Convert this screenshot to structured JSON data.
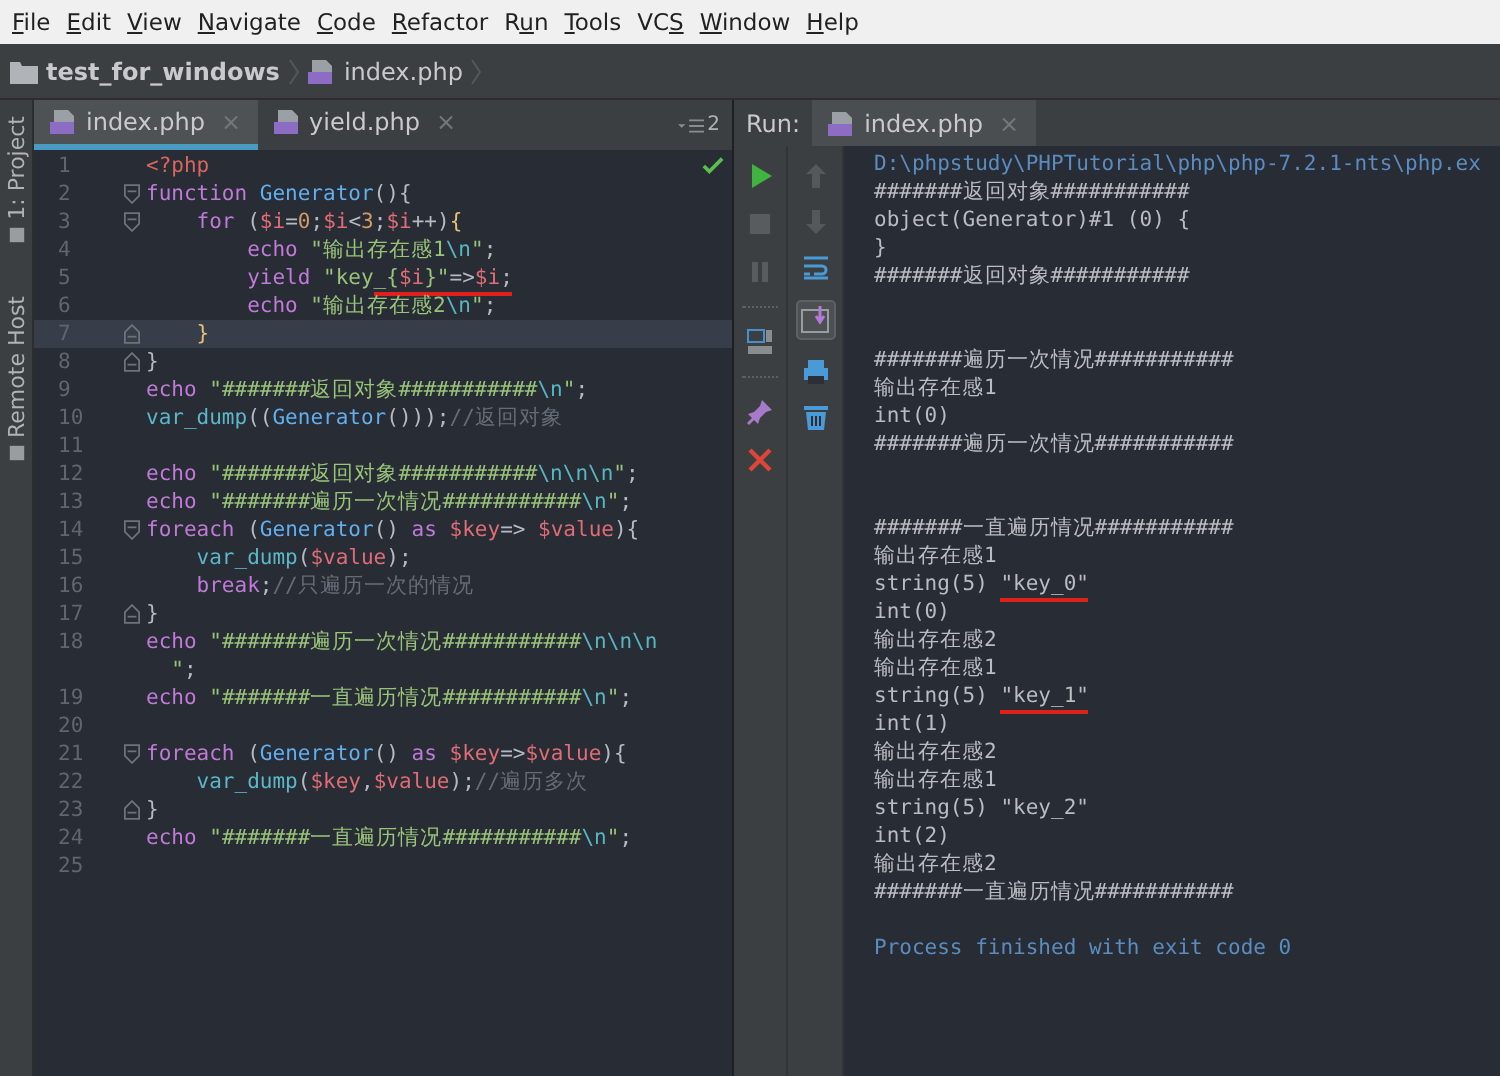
{
  "menu": [
    {
      "key": "F",
      "post": "ile"
    },
    {
      "key": "E",
      "post": "dit"
    },
    {
      "key": "V",
      "post": "iew"
    },
    {
      "key": "N",
      "post": "avigate"
    },
    {
      "key": "C",
      "post": "ode"
    },
    {
      "key": "R",
      "post": "efactor"
    },
    {
      "pre": "R",
      "key": "u",
      "post": "n"
    },
    {
      "key": "T",
      "post": "ools"
    },
    {
      "pre": "VC",
      "key": "S"
    },
    {
      "key": "W",
      "post": "indow"
    },
    {
      "key": "H",
      "post": "elp"
    }
  ],
  "breadcrumb": {
    "project": "test_for_windows",
    "file": "index.php"
  },
  "tool_strip": [
    {
      "label": "1: Project"
    },
    {
      "label": "Remote Host"
    }
  ],
  "editor": {
    "tabs": [
      {
        "label": "index.php",
        "close": "×",
        "selected": true
      },
      {
        "label": "yield.php",
        "close": "×",
        "selected": false
      }
    ],
    "tab_count": "2",
    "lines": [
      {
        "number": "1",
        "current": false,
        "kind": "plain",
        "segments": [
          {
            "kind": "tag",
            "text": "<?php"
          }
        ]
      },
      {
        "number": "2",
        "current": false,
        "kind": "fold-start",
        "segments": [
          {
            "kind": "kw",
            "text": "function"
          },
          {
            "kind": "fn",
            "text": " Generator"
          },
          {
            "kind": "plain",
            "text": "(){"
          }
        ]
      },
      {
        "number": "3",
        "current": false,
        "kind": "fold-start",
        "segments": [
          {
            "kind": "kw",
            "text": "    for"
          },
          {
            "kind": "plain",
            "text": " ("
          },
          {
            "kind": "var",
            "text": "$i"
          },
          {
            "kind": "plain",
            "text": "="
          },
          {
            "kind": "num",
            "text": "0"
          },
          {
            "kind": "plain",
            "text": ";"
          },
          {
            "kind": "var",
            "text": "$i"
          },
          {
            "kind": "plain",
            "text": "<"
          },
          {
            "kind": "num",
            "text": "3"
          },
          {
            "kind": "plain",
            "text": ";"
          },
          {
            "kind": "var",
            "text": "$i"
          },
          {
            "kind": "plain",
            "text": "++)"
          },
          {
            "kind": "brace",
            "text": "{"
          }
        ]
      },
      {
        "number": "4",
        "current": false,
        "kind": "plain",
        "segments": [
          {
            "kind": "kw",
            "text": "        echo"
          },
          {
            "kind": "str",
            "text": " \"输出存在感1"
          },
          {
            "kind": "esc",
            "text": "\\n"
          },
          {
            "kind": "str",
            "text": "\""
          },
          {
            "kind": "plain",
            "text": ";"
          }
        ]
      },
      {
        "number": "5",
        "current": false,
        "kind": "plain",
        "segments": [
          {
            "kind": "kw",
            "text": "        yield"
          },
          {
            "kind": "str",
            "text": " \"key"
          },
          {
            "kind": "annotated",
            "segments": [
              {
                "kind": "str",
                "text": "_{"
              },
              {
                "kind": "var",
                "text": "$i"
              },
              {
                "kind": "str",
                "text": "}\""
              },
              {
                "kind": "plain",
                "text": "=>"
              },
              {
                "kind": "var",
                "text": "$i"
              },
              {
                "kind": "plain",
                "text": ";"
              }
            ]
          }
        ]
      },
      {
        "number": "6",
        "current": false,
        "kind": "plain",
        "segments": [
          {
            "kind": "kw",
            "text": "        echo"
          },
          {
            "kind": "str",
            "text": " \"输出存在感2"
          },
          {
            "kind": "esc",
            "text": "\\n"
          },
          {
            "kind": "str",
            "text": "\""
          },
          {
            "kind": "plain",
            "text": ";"
          }
        ]
      },
      {
        "number": "7",
        "current": true,
        "kind": "fold-end",
        "segments": [
          {
            "kind": "brace",
            "text": "    }"
          }
        ]
      },
      {
        "number": "8",
        "current": false,
        "kind": "fold-end",
        "segments": [
          {
            "kind": "plain",
            "text": "}"
          }
        ]
      },
      {
        "number": "9",
        "current": false,
        "kind": "plain",
        "segments": [
          {
            "kind": "kw",
            "text": "echo"
          },
          {
            "kind": "str",
            "text": " \"#######返回对象###########"
          },
          {
            "kind": "esc",
            "text": "\\n"
          },
          {
            "kind": "str",
            "text": "\""
          },
          {
            "kind": "plain",
            "text": ";"
          }
        ]
      },
      {
        "number": "10",
        "current": false,
        "kind": "plain",
        "segments": [
          {
            "kind": "builtin",
            "text": "var_dump"
          },
          {
            "kind": "plain",
            "text": "(("
          },
          {
            "kind": "fn",
            "text": "Generator"
          },
          {
            "kind": "plain",
            "text": "()));"
          },
          {
            "kind": "comment",
            "text": "//返回对象"
          }
        ]
      },
      {
        "number": "11",
        "current": false,
        "kind": "plain"
      },
      {
        "number": "12",
        "current": false,
        "kind": "plain",
        "segments": [
          {
            "kind": "kw",
            "text": "echo"
          },
          {
            "kind": "str",
            "text": " \"#######返回对象###########"
          },
          {
            "kind": "esc",
            "text": "\\n\\n\\n"
          },
          {
            "kind": "str",
            "text": "\""
          },
          {
            "kind": "plain",
            "text": ";"
          }
        ]
      },
      {
        "number": "13",
        "current": false,
        "kind": "plain",
        "segments": [
          {
            "kind": "kw",
            "text": "echo"
          },
          {
            "kind": "str",
            "text": " \"#######遍历一次情况###########"
          },
          {
            "kind": "esc",
            "text": "\\n"
          },
          {
            "kind": "str",
            "text": "\""
          },
          {
            "kind": "plain",
            "text": ";"
          }
        ]
      },
      {
        "number": "14",
        "current": false,
        "kind": "fold-start",
        "segments": [
          {
            "kind": "kw",
            "text": "foreach"
          },
          {
            "kind": "plain",
            "text": " ("
          },
          {
            "kind": "fn",
            "text": "Generator"
          },
          {
            "kind": "plain",
            "text": "()"
          },
          {
            "kind": "kw",
            "text": " as"
          },
          {
            "kind": "var",
            "text": " $key"
          },
          {
            "kind": "plain",
            "text": "=>"
          },
          {
            "kind": "var",
            "text": " $value"
          },
          {
            "kind": "plain",
            "text": "){"
          }
        ]
      },
      {
        "number": "15",
        "current": false,
        "kind": "plain",
        "segments": [
          {
            "kind": "builtin",
            "text": "    var_dump"
          },
          {
            "kind": "plain",
            "text": "("
          },
          {
            "kind": "var",
            "text": "$value"
          },
          {
            "kind": "plain",
            "text": ");"
          }
        ]
      },
      {
        "number": "16",
        "current": false,
        "kind": "plain",
        "segments": [
          {
            "kind": "kw",
            "text": "    break"
          },
          {
            "kind": "plain",
            "text": ";"
          },
          {
            "kind": "comment",
            "text": "//只遍历一次的情况"
          }
        ]
      },
      {
        "number": "17",
        "current": false,
        "kind": "fold-end",
        "segments": [
          {
            "kind": "plain",
            "text": "}"
          }
        ]
      },
      {
        "number": "18",
        "current": false,
        "kind": "plain",
        "segments": [
          {
            "kind": "kw",
            "text": "echo"
          },
          {
            "kind": "str",
            "text": " \"#######遍历一次情况###########"
          },
          {
            "kind": "esc",
            "text": "\\n\\n\\n"
          }
        ],
        "continuation": [
          {
            "kind": "str",
            "text": "  \""
          },
          {
            "kind": "plain",
            "text": ";"
          }
        ]
      },
      {
        "number": "19",
        "current": false,
        "kind": "plain",
        "segments": [
          {
            "kind": "kw",
            "text": "echo"
          },
          {
            "kind": "str",
            "text": " \"#######一直遍历情况###########"
          },
          {
            "kind": "esc",
            "text": "\\n"
          },
          {
            "kind": "str",
            "text": "\""
          },
          {
            "kind": "plain",
            "text": ";"
          }
        ]
      },
      {
        "number": "20",
        "current": false,
        "kind": "plain"
      },
      {
        "number": "21",
        "current": false,
        "kind": "fold-start",
        "segments": [
          {
            "kind": "kw",
            "text": "foreach"
          },
          {
            "kind": "plain",
            "text": " ("
          },
          {
            "kind": "fn",
            "text": "Generator"
          },
          {
            "kind": "plain",
            "text": "()"
          },
          {
            "kind": "kw",
            "text": " as"
          },
          {
            "kind": "var",
            "text": " $key"
          },
          {
            "kind": "plain",
            "text": "=>"
          },
          {
            "kind": "var",
            "text": "$value"
          },
          {
            "kind": "plain",
            "text": "){"
          }
        ]
      },
      {
        "number": "22",
        "current": false,
        "kind": "plain",
        "segments": [
          {
            "kind": "builtin",
            "text": "    var_dump"
          },
          {
            "kind": "plain",
            "text": "("
          },
          {
            "kind": "var",
            "text": "$key"
          },
          {
            "kind": "plain",
            "text": ","
          },
          {
            "kind": "var",
            "text": "$value"
          },
          {
            "kind": "plain",
            "text": ");"
          },
          {
            "kind": "comment",
            "text": "//遍历多次"
          }
        ]
      },
      {
        "number": "23",
        "current": false,
        "kind": "fold-end",
        "segments": [
          {
            "kind": "plain",
            "text": "}"
          }
        ]
      },
      {
        "number": "24",
        "current": false,
        "kind": "plain",
        "segments": [
          {
            "kind": "kw",
            "text": "echo"
          },
          {
            "kind": "str",
            "text": " \"#######一直遍历情况###########"
          },
          {
            "kind": "esc",
            "text": "\\n"
          },
          {
            "kind": "str",
            "text": "\""
          },
          {
            "kind": "plain",
            "text": ";"
          }
        ]
      },
      {
        "number": "25",
        "current": false,
        "kind": "plain"
      }
    ]
  },
  "run": {
    "label": "Run:",
    "tab": "index.php",
    "tab_close": "×",
    "output": [
      {
        "kind": "command",
        "text": "D:\\phpstudy\\PHPTutorial\\php\\php-7.2.1-nts\\php.ex"
      },
      {
        "kind": "text",
        "text": "#######返回对象###########"
      },
      {
        "kind": "text",
        "text": "object(Generator)#1 (0) {"
      },
      {
        "kind": "text",
        "text": "}"
      },
      {
        "kind": "text",
        "text": "#######返回对象###########"
      },
      {
        "kind": "blank"
      },
      {
        "kind": "blank"
      },
      {
        "kind": "text",
        "text": "#######遍历一次情况###########"
      },
      {
        "kind": "text",
        "text": "输出存在感1"
      },
      {
        "kind": "text",
        "text": "int(0)"
      },
      {
        "kind": "text",
        "text": "#######遍历一次情况###########"
      },
      {
        "kind": "blank"
      },
      {
        "kind": "blank"
      },
      {
        "kind": "text",
        "text": "#######一直遍历情况###########"
      },
      {
        "kind": "text",
        "text": "输出存在感1"
      },
      {
        "kind": "marked",
        "text": "string(5) ",
        "mark": "\"key_0\""
      },
      {
        "kind": "text",
        "text": "int(0)"
      },
      {
        "kind": "text",
        "text": "输出存在感2"
      },
      {
        "kind": "text",
        "text": "输出存在感1"
      },
      {
        "kind": "marked",
        "text": "string(5) ",
        "mark": "\"key_1\""
      },
      {
        "kind": "text",
        "text": "int(1)"
      },
      {
        "kind": "text",
        "text": "输出存在感2"
      },
      {
        "kind": "text",
        "text": "输出存在感1"
      },
      {
        "kind": "text",
        "text": "string(5) \"key_2\""
      },
      {
        "kind": "text",
        "text": "int(2)"
      },
      {
        "kind": "text",
        "text": "输出存在感2"
      },
      {
        "kind": "text",
        "text": "#######一直遍历情况###########"
      },
      {
        "kind": "blank"
      },
      {
        "kind": "exit",
        "text": "Process finished with exit code 0"
      }
    ]
  }
}
